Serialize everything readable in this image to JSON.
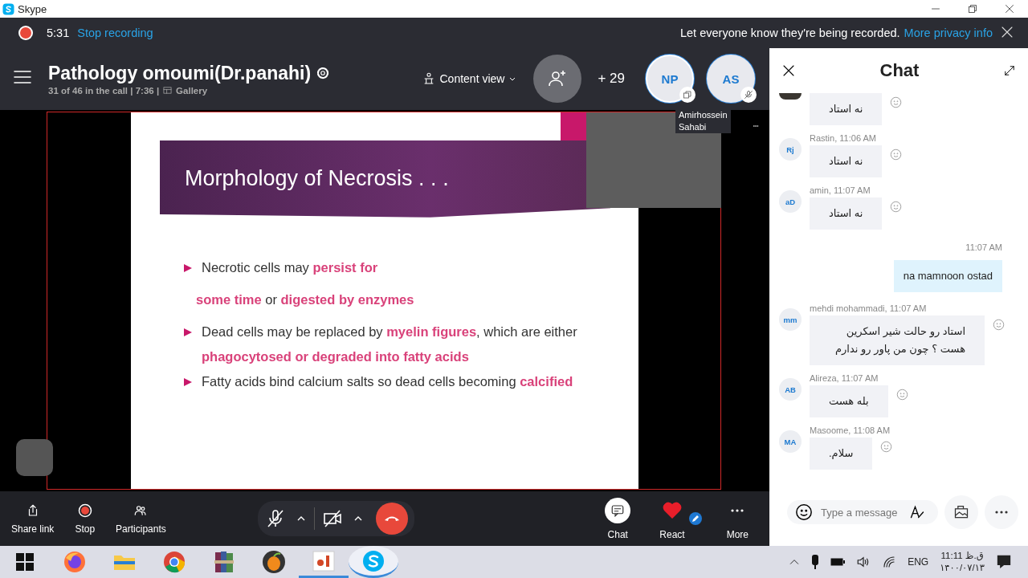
{
  "window": {
    "title": "Skype"
  },
  "recording": {
    "time": "5:31",
    "stop_link": "Stop recording",
    "notice": "Let everyone know they're being recorded.",
    "privacy_link": "More privacy info"
  },
  "call": {
    "title": "Pathology omoumi(Dr.panahi)",
    "status": "31 of 46 in the call | 7:36 |",
    "view": "Gallery",
    "content_view": "Content view",
    "extra_count": "+ 29",
    "avatars": [
      {
        "initials": "NP",
        "kind": "screen"
      },
      {
        "initials": "AS",
        "kind": "muted"
      }
    ],
    "tile_name": "Amirhossein Sahabi"
  },
  "slide": {
    "title": "Morphology of Necrosis . . .",
    "lines": [
      {
        "kind": "bullet",
        "text": "Necrotic cells may **persist for**"
      },
      {
        "kind": "continuation",
        "text": "**some time** or **digested by enzymes**"
      },
      {
        "kind": "bullet",
        "text": "Dead cells may be replaced by **myelin figures**, which are either **phagocytosed or  degraded into fatty acids**"
      },
      {
        "kind": "bullet",
        "text": "Fatty acids bind calcium salts so dead cells  becoming **calcified**"
      }
    ]
  },
  "controls": {
    "left": [
      {
        "kind": "share",
        "label": "Share link"
      },
      {
        "kind": "record",
        "label": "Stop"
      },
      {
        "kind": "people",
        "label": "Participants"
      }
    ],
    "mic_on": false,
    "camera_on": false,
    "right": [
      {
        "kind": "chat",
        "label": "Chat",
        "selected": true
      },
      {
        "kind": "heart",
        "label": "React",
        "selected": false
      },
      {
        "kind": "more",
        "label": "More",
        "selected": false
      }
    ]
  },
  "chat": {
    "title": "Chat",
    "messages": [
      {
        "kind": "cut",
        "text": "نه استاد"
      },
      {
        "kind": "incoming",
        "initials": "Rj",
        "meta": "Rastin, 11:06 AM",
        "text": "نه استاد"
      },
      {
        "kind": "incoming",
        "initials": "aD",
        "meta": "amin, 11:07 AM",
        "text": "نه استاد"
      },
      {
        "kind": "outgoing",
        "meta": "11:07 AM",
        "text": "na mamnoon ostad"
      },
      {
        "kind": "incoming",
        "initials": "mm",
        "meta": "mehdi mohammadi, 11:07 AM",
        "text": "استاد رو حالت شیر اسکرین هست ؟ چون من پاور رو ندارم"
      },
      {
        "kind": "incoming",
        "initials": "AB",
        "meta": "Alireza, 11:07 AM",
        "text": "بله هست"
      },
      {
        "kind": "incoming",
        "initials": "MA",
        "meta": "Masoome, 11:08 AM",
        "text": "سلام."
      }
    ],
    "input": {
      "placeholder": "Type a message"
    }
  },
  "taskbar": {
    "apps": [
      {
        "kind": "firefox",
        "running": false,
        "selected": false
      },
      {
        "kind": "folder",
        "running": false,
        "selected": false
      },
      {
        "kind": "chrome",
        "running": false,
        "selected": false
      },
      {
        "kind": "books",
        "running": false,
        "selected": false
      },
      {
        "kind": "fruit",
        "running": false,
        "selected": false
      },
      {
        "kind": "slides",
        "running": true,
        "selected": false
      },
      {
        "kind": "skype",
        "running": true,
        "selected": true
      }
    ],
    "language": "ENG",
    "time": "11:11 ق.ظ",
    "date": "۱۴۰۰/۰۷/۱۳"
  }
}
